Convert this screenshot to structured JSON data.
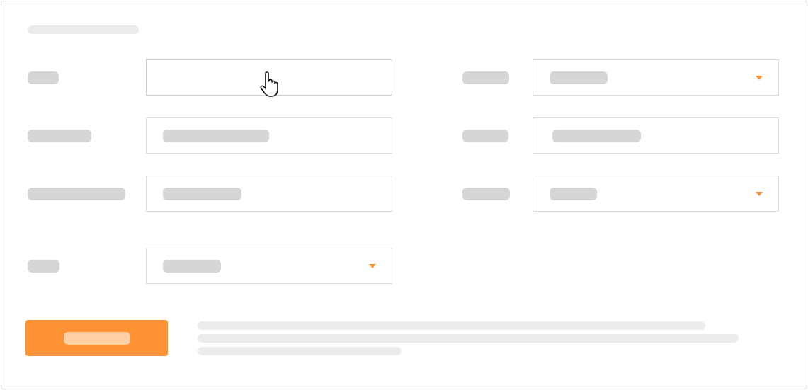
{
  "form": {
    "rows": [
      {
        "left": {
          "kind": "text",
          "filled": false,
          "hovered": true
        },
        "right": {
          "kind": "select",
          "filled": true,
          "hovered": false
        }
      },
      {
        "left": {
          "kind": "text",
          "filled": true,
          "hovered": false
        },
        "right": {
          "kind": "text",
          "filled": true,
          "hovered": false
        }
      },
      {
        "left": {
          "kind": "text",
          "filled": true,
          "hovered": false
        },
        "right": {
          "kind": "select",
          "filled": true,
          "hovered": false
        }
      },
      {
        "left": {
          "kind": "select",
          "filled": true,
          "hovered": false
        }
      }
    ]
  }
}
